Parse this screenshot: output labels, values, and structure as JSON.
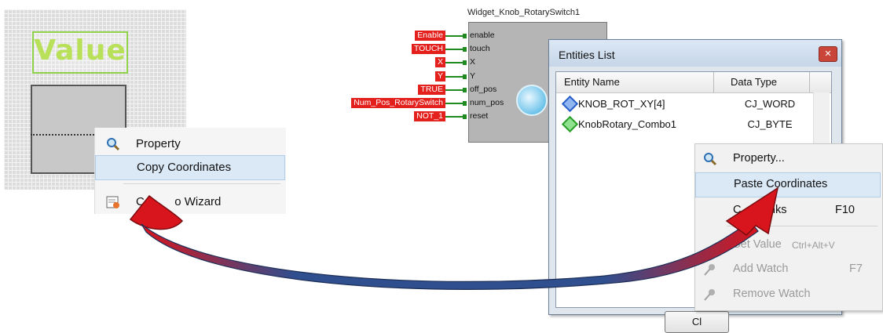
{
  "left_panel": {
    "value_label": "Value"
  },
  "left_menu": {
    "items": [
      {
        "label": "Property",
        "icon": "magnifier-icon"
      },
      {
        "label": "Copy Coordinates",
        "icon": ""
      },
      {
        "label": "Config Wizard",
        "icon": "wizard-icon"
      }
    ],
    "visible_wizard_text": "Co",
    "visible_wizard_text_end": "o Wizard"
  },
  "widget": {
    "title": "Widget_Knob_RotarySwitch1",
    "inputs": [
      {
        "signal": "Enable",
        "pin": "enable"
      },
      {
        "signal": "TOUCH",
        "pin": "touch"
      },
      {
        "signal": "X",
        "pin": "X"
      },
      {
        "signal": "Y",
        "pin": "Y"
      },
      {
        "signal": "TRUE",
        "pin": "off_pos"
      },
      {
        "signal": "Num_Pos_RotarySwitch",
        "pin": "num_pos"
      },
      {
        "signal": "NOT_1",
        "pin": "reset"
      }
    ]
  },
  "entities_window": {
    "title": "Entities List",
    "columns": [
      "Entity Name",
      "Data Type"
    ],
    "rows": [
      {
        "name": "KNOB_ROT_XY[4]",
        "type": "CJ_WORD",
        "color": "#2a5fc9"
      },
      {
        "name": "KnobRotary_Combo1",
        "type": "CJ_BYTE",
        "color": "#2aa02a"
      }
    ],
    "close_button": "Cl"
  },
  "right_menu": {
    "items": [
      {
        "label": "Property...",
        "shortcut": "",
        "disabled": false,
        "icon": "magnifier-icon"
      },
      {
        "label": "Paste Coordinates",
        "shortcut": "",
        "disabled": false,
        "icon": ""
      },
      {
        "label": "Check Links",
        "visible_label": "C      Links",
        "shortcut": "F10",
        "disabled": false,
        "icon": ""
      },
      {
        "label": "Set Value",
        "shortcut": "Ctrl+Alt+V",
        "disabled": true,
        "icon": ""
      },
      {
        "label": "Add Watch",
        "shortcut": "F7",
        "disabled": true,
        "icon": "pin-icon"
      },
      {
        "label": "Remove Watch",
        "shortcut": "",
        "disabled": true,
        "icon": "pin-icon"
      }
    ]
  },
  "colors": {
    "signal_red": "#e3201b",
    "wire_green": "#1f8a1f",
    "arrow_red": "#d8141c",
    "arrow_blue": "#2f4f8f",
    "menu_highlight": "#dbe8f6"
  }
}
